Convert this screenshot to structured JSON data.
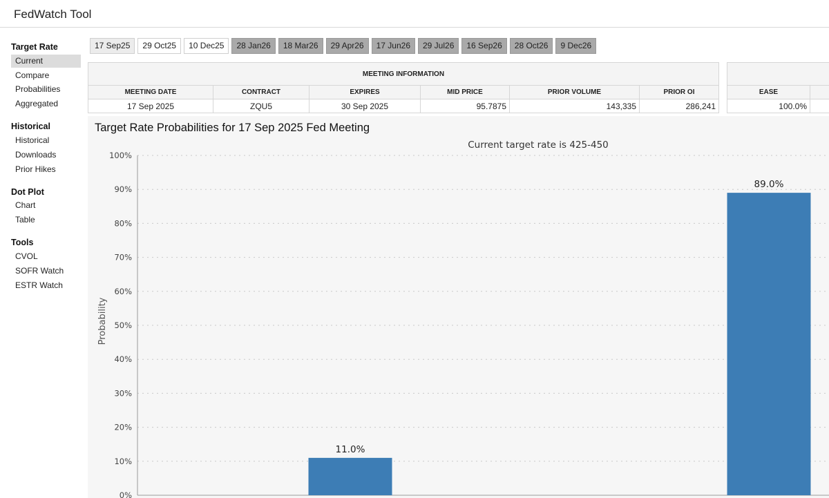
{
  "app": {
    "title": "FedWatch Tool"
  },
  "sidebar": {
    "sections": [
      {
        "title": "Target Rate",
        "items": [
          "Current",
          "Compare",
          "Probabilities",
          "Aggregated"
        ],
        "active": 0
      },
      {
        "title": "Historical",
        "items": [
          "Historical",
          "Downloads",
          "Prior Hikes"
        ]
      },
      {
        "title": "Dot Plot",
        "items": [
          "Chart",
          "Table"
        ]
      },
      {
        "title": "Tools",
        "items": [
          "CVOL",
          "SOFR Watch",
          "ESTR Watch"
        ]
      }
    ]
  },
  "tabs": [
    {
      "label": "17 Sep25",
      "state": "selected"
    },
    {
      "label": "29 Oct25",
      "state": "normal"
    },
    {
      "label": "10 Dec25",
      "state": "normal"
    },
    {
      "label": "28 Jan26",
      "state": "future"
    },
    {
      "label": "18 Mar26",
      "state": "future"
    },
    {
      "label": "29 Apr26",
      "state": "future"
    },
    {
      "label": "17 Jun26",
      "state": "future"
    },
    {
      "label": "29 Jul26",
      "state": "future"
    },
    {
      "label": "16 Sep26",
      "state": "future"
    },
    {
      "label": "28 Oct26",
      "state": "future"
    },
    {
      "label": "9 Dec26",
      "state": "future"
    }
  ],
  "meeting_info": {
    "caption": "MEETING INFORMATION",
    "headers": [
      "MEETING DATE",
      "CONTRACT",
      "EXPIRES",
      "MID PRICE",
      "PRIOR VOLUME",
      "PRIOR OI"
    ],
    "row": [
      "17 Sep 2025",
      "ZQU5",
      "30 Sep 2025",
      "95.7875",
      "143,335",
      "286,241"
    ]
  },
  "probabilities_table": {
    "headers": [
      "EASE"
    ],
    "row": [
      "100.0%"
    ]
  },
  "chart_title": "Target Rate Probabilities for 17 Sep 2025 Fed Meeting",
  "chart_data": {
    "type": "bar",
    "subtitle": "Current target rate is 425-450",
    "ylabel": "Probability",
    "ylim": [
      0,
      100
    ],
    "yticks": [
      "0%",
      "10%",
      "20%",
      "30%",
      "40%",
      "50%",
      "60%",
      "70%",
      "80%",
      "90%",
      "100%"
    ],
    "grid": true,
    "values": [
      11.0,
      89.0
    ],
    "data_labels": [
      "11.0%",
      "89.0%"
    ],
    "color": "#3d7db5"
  }
}
